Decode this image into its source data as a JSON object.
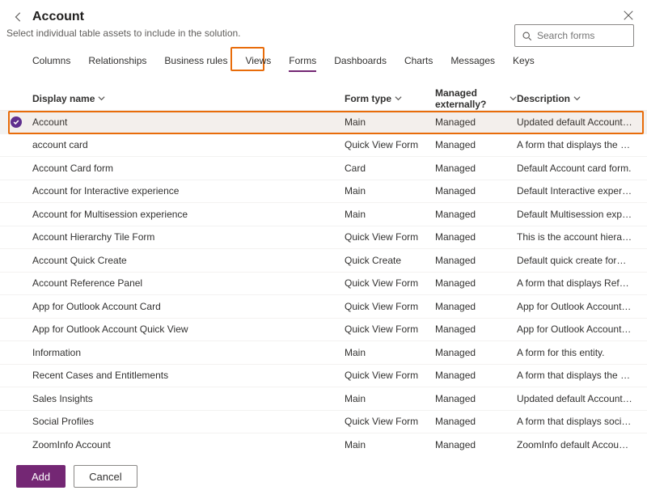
{
  "header": {
    "title": "Account",
    "subtitle": "Select individual table assets to include in the solution."
  },
  "search": {
    "placeholder": "Search forms"
  },
  "tabs": {
    "items": [
      {
        "label": "Columns"
      },
      {
        "label": "Relationships"
      },
      {
        "label": "Business rules"
      },
      {
        "label": "Views"
      },
      {
        "label": "Forms",
        "active": true
      },
      {
        "label": "Dashboards"
      },
      {
        "label": "Charts"
      },
      {
        "label": "Messages"
      },
      {
        "label": "Keys"
      }
    ]
  },
  "columns": {
    "display_name": "Display name",
    "form_type": "Form type",
    "managed_externally": "Managed externally?",
    "description": "Description"
  },
  "rows": [
    {
      "selected": true,
      "name": "Account",
      "type": "Main",
      "managed": "Managed",
      "desc": "Updated default Account form."
    },
    {
      "selected": false,
      "name": "account card",
      "type": "Quick View Form",
      "managed": "Managed",
      "desc": "A form that displays the account card."
    },
    {
      "selected": false,
      "name": "Account Card form",
      "type": "Card",
      "managed": "Managed",
      "desc": "Default Account card form."
    },
    {
      "selected": false,
      "name": "Account for Interactive experience",
      "type": "Main",
      "managed": "Managed",
      "desc": "Default Interactive experience Account"
    },
    {
      "selected": false,
      "name": "Account for Multisession experience",
      "type": "Main",
      "managed": "Managed",
      "desc": "Default Multisession experience Accoun"
    },
    {
      "selected": false,
      "name": "Account Hierarchy Tile Form",
      "type": "Quick View Form",
      "managed": "Managed",
      "desc": "This is the account hierarchy definition."
    },
    {
      "selected": false,
      "name": "Account Quick Create",
      "type": "Quick Create",
      "managed": "Managed",
      "desc": "Default quick create form for Account"
    },
    {
      "selected": false,
      "name": "Account Reference Panel",
      "type": "Quick View Form",
      "managed": "Managed",
      "desc": "A form that displays Reference Panel of"
    },
    {
      "selected": false,
      "name": "App for Outlook Account Card",
      "type": "Quick View Form",
      "managed": "Managed",
      "desc": "App for Outlook Account Card"
    },
    {
      "selected": false,
      "name": "App for Outlook Account Quick View",
      "type": "Quick View Form",
      "managed": "Managed",
      "desc": "App for Outlook Account Quick View"
    },
    {
      "selected": false,
      "name": "Information",
      "type": "Main",
      "managed": "Managed",
      "desc": "A form for this entity."
    },
    {
      "selected": false,
      "name": "Recent Cases and Entitlements",
      "type": "Quick View Form",
      "managed": "Managed",
      "desc": "A form that displays the recent cases an"
    },
    {
      "selected": false,
      "name": "Sales Insights",
      "type": "Main",
      "managed": "Managed",
      "desc": "Updated default Account form."
    },
    {
      "selected": false,
      "name": "Social Profiles",
      "type": "Quick View Form",
      "managed": "Managed",
      "desc": "A form that displays social profiles of ac"
    },
    {
      "selected": false,
      "name": "ZoomInfo Account",
      "type": "Main",
      "managed": "Managed",
      "desc": "ZoomInfo default Account form."
    }
  ],
  "footer": {
    "add": "Add",
    "cancel": "Cancel"
  }
}
